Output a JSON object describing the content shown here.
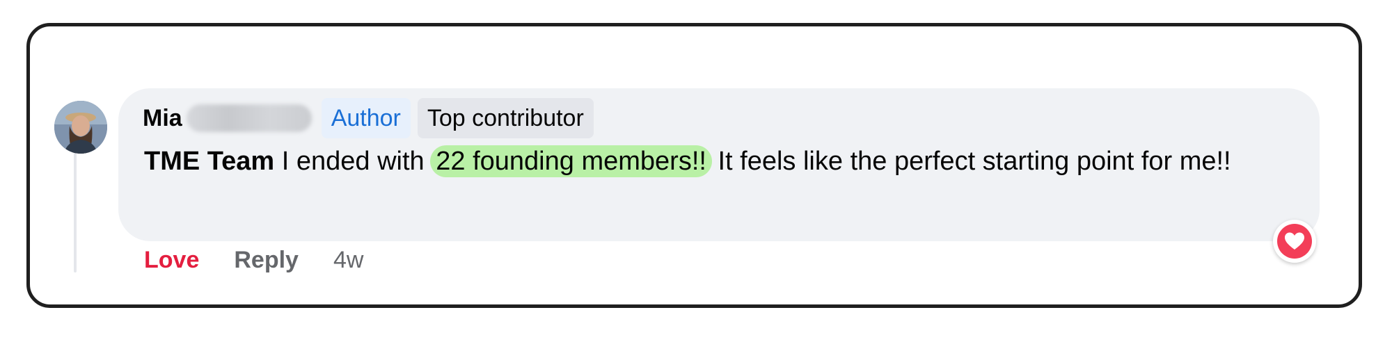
{
  "comment": {
    "author_first_name": "Mia",
    "badges": {
      "author": "Author",
      "top_contributor": "Top contributor"
    },
    "mention": "TME Team",
    "text_before": " I ended with ",
    "highlighted_text": "22 founding members!!",
    "text_after": " It feels like the perfect starting point for me!!",
    "reaction_icon": "love-heart-icon"
  },
  "actions": {
    "love_label": "Love",
    "reply_label": "Reply",
    "timestamp": "4w"
  },
  "colors": {
    "love_red": "#e41e3f",
    "author_badge_blue": "#1a6fd6",
    "highlight_green": "#b9f0a6",
    "bubble_bg": "#f0f2f5"
  }
}
